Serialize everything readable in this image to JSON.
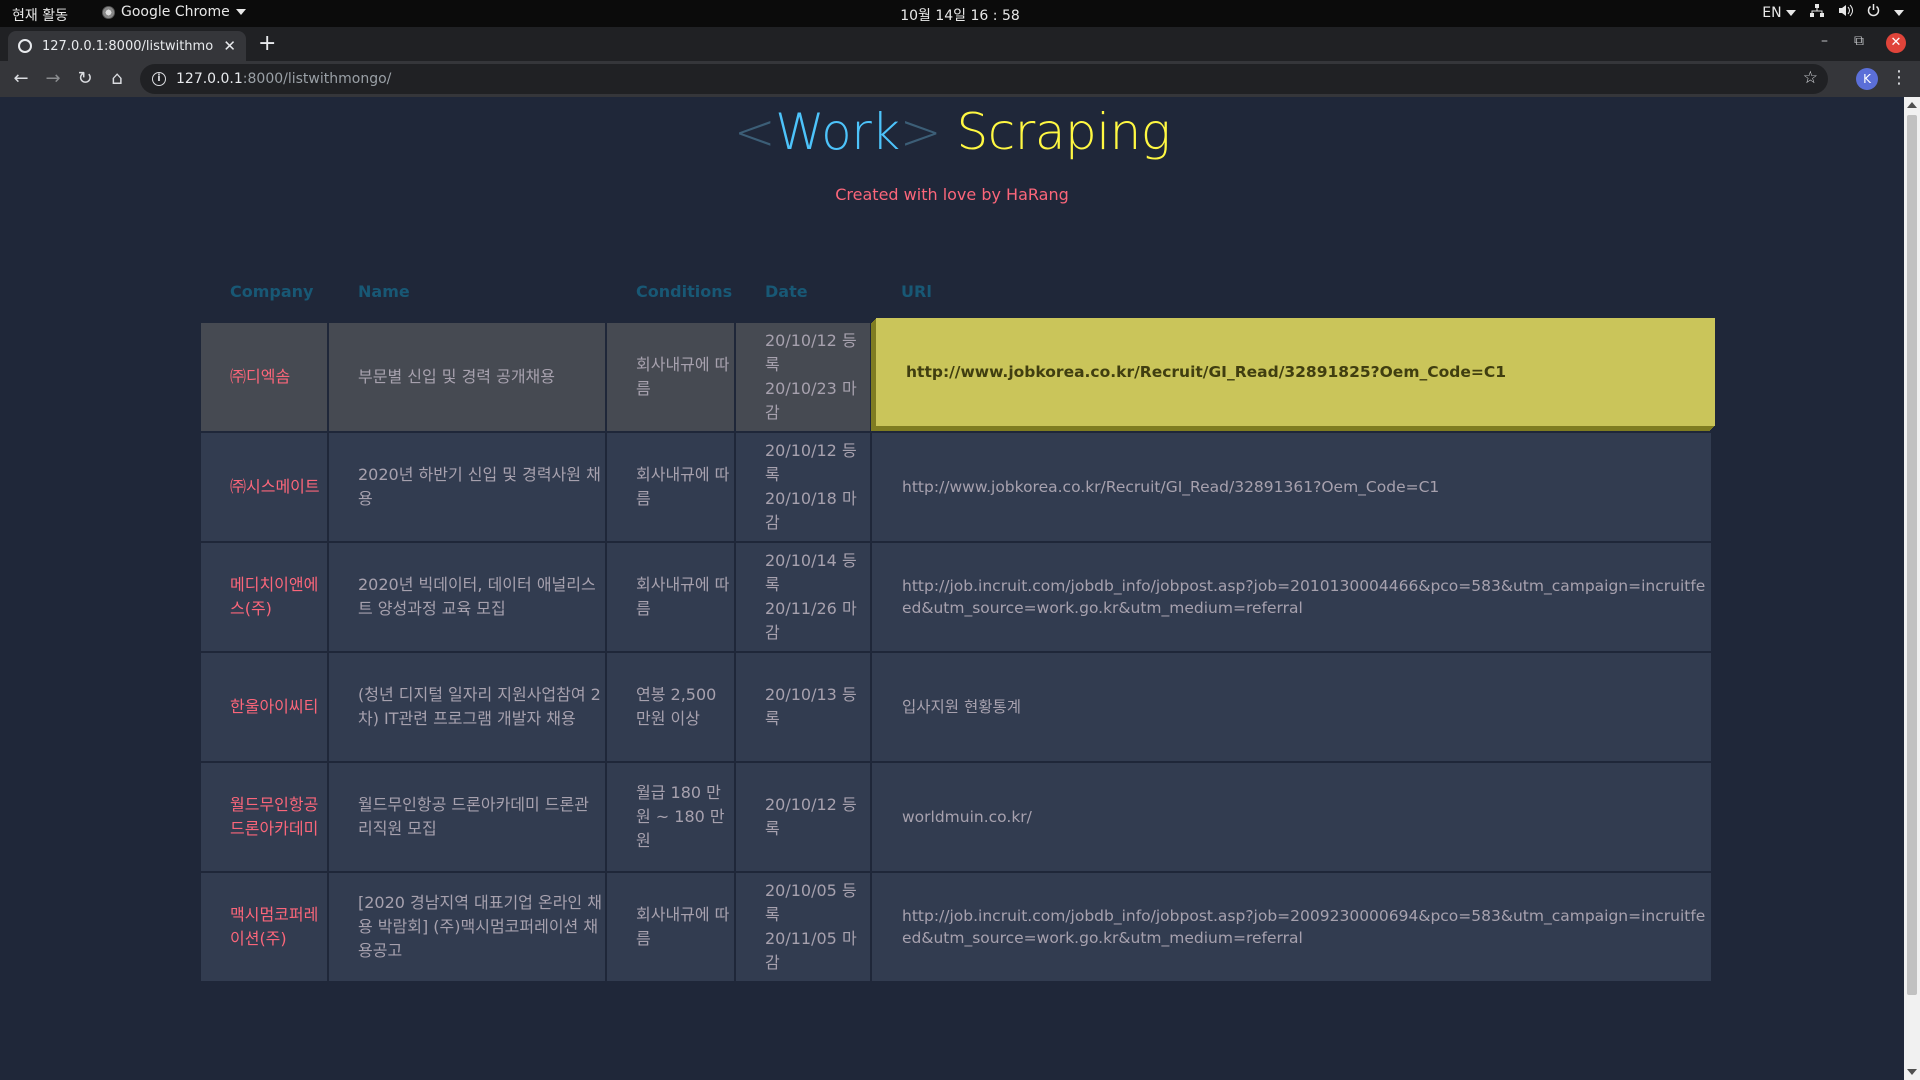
{
  "system_bar": {
    "activities": "현재 활동",
    "app_name": "Google Chrome",
    "clock": "10월 14일  16 : 58",
    "language": "EN"
  },
  "browser": {
    "tab_title": "127.0.0.1:8000/listwithmo",
    "url_host": "127.0.0.1",
    "url_path": ":8000/listwithmongo/",
    "profile_initial": "K"
  },
  "page": {
    "title_open": "<",
    "title_work": "Work",
    "title_close": ">",
    "title_rest": " Scraping",
    "subtitle": "Created with love by HaRang"
  },
  "table": {
    "headers": {
      "company": "Company",
      "name": "Name",
      "conditions": "Conditions",
      "date": "Date",
      "url": "URl"
    },
    "rows": [
      {
        "company": "㈜디엑솜",
        "name": "부문별 신입 및 경력 공개채용",
        "conditions": "회사내규에 따름",
        "reg": "20/10/12 등록",
        "due": "20/10/23 마감",
        "url": "http://www.jobkorea.co.kr/Recruit/GI_Read/32891825?Oem_Code=C1"
      },
      {
        "company": "㈜시스메이트",
        "name": "2020년 하반기 신입 및 경력사원 채용",
        "conditions": "회사내규에 따름",
        "reg": "20/10/12 등록",
        "due": "20/10/18 마감",
        "url": "http://www.jobkorea.co.kr/Recruit/GI_Read/32891361?Oem_Code=C1"
      },
      {
        "company": "메디치이앤에스(주)",
        "name": "2020년 빅데이터, 데이터 애널리스트 양성과정 교육 모집",
        "conditions": "회사내규에 따름",
        "reg": "20/10/14 등록",
        "due": "20/11/26 마감",
        "url": "http://job.incruit.com/jobdb_info/jobpost.asp?job=2010130004466&pco=583&utm_campaign=incruitfeed&utm_source=work.go.kr&utm_medium=referral"
      },
      {
        "company": "한울아이씨티",
        "name": "(청년 디지털 일자리 지원사업참여 2차) IT관련 프로그램 개발자 채용",
        "conditions": "연봉 2,500 만원 이상",
        "reg": "20/10/13 등록",
        "due": "",
        "url": "입사지원 현황통계"
      },
      {
        "company": "월드무인항공드론아카데미",
        "name": "월드무인항공 드론아카데미 드론관리직원 모집",
        "conditions": "월급 180 만원 ~ 180 만원",
        "reg": "20/10/12 등록",
        "due": "",
        "url": "worldmuin.co.kr/"
      },
      {
        "company": "맥시멈코퍼레이션(주)",
        "name": "[2020 경남지역 대표기업 온라인 채용 박람회] (주)맥시멈코퍼레이션 채용공고",
        "conditions": "회사내규에 따름",
        "reg": "20/10/05 등록",
        "due": "20/11/05 마감",
        "url": "http://job.incruit.com/jobdb_info/jobpost.asp?job=2009230000694&pco=583&utm_campaign=incruitfeed&utm_source=work.go.kr&utm_medium=referral"
      }
    ]
  }
}
